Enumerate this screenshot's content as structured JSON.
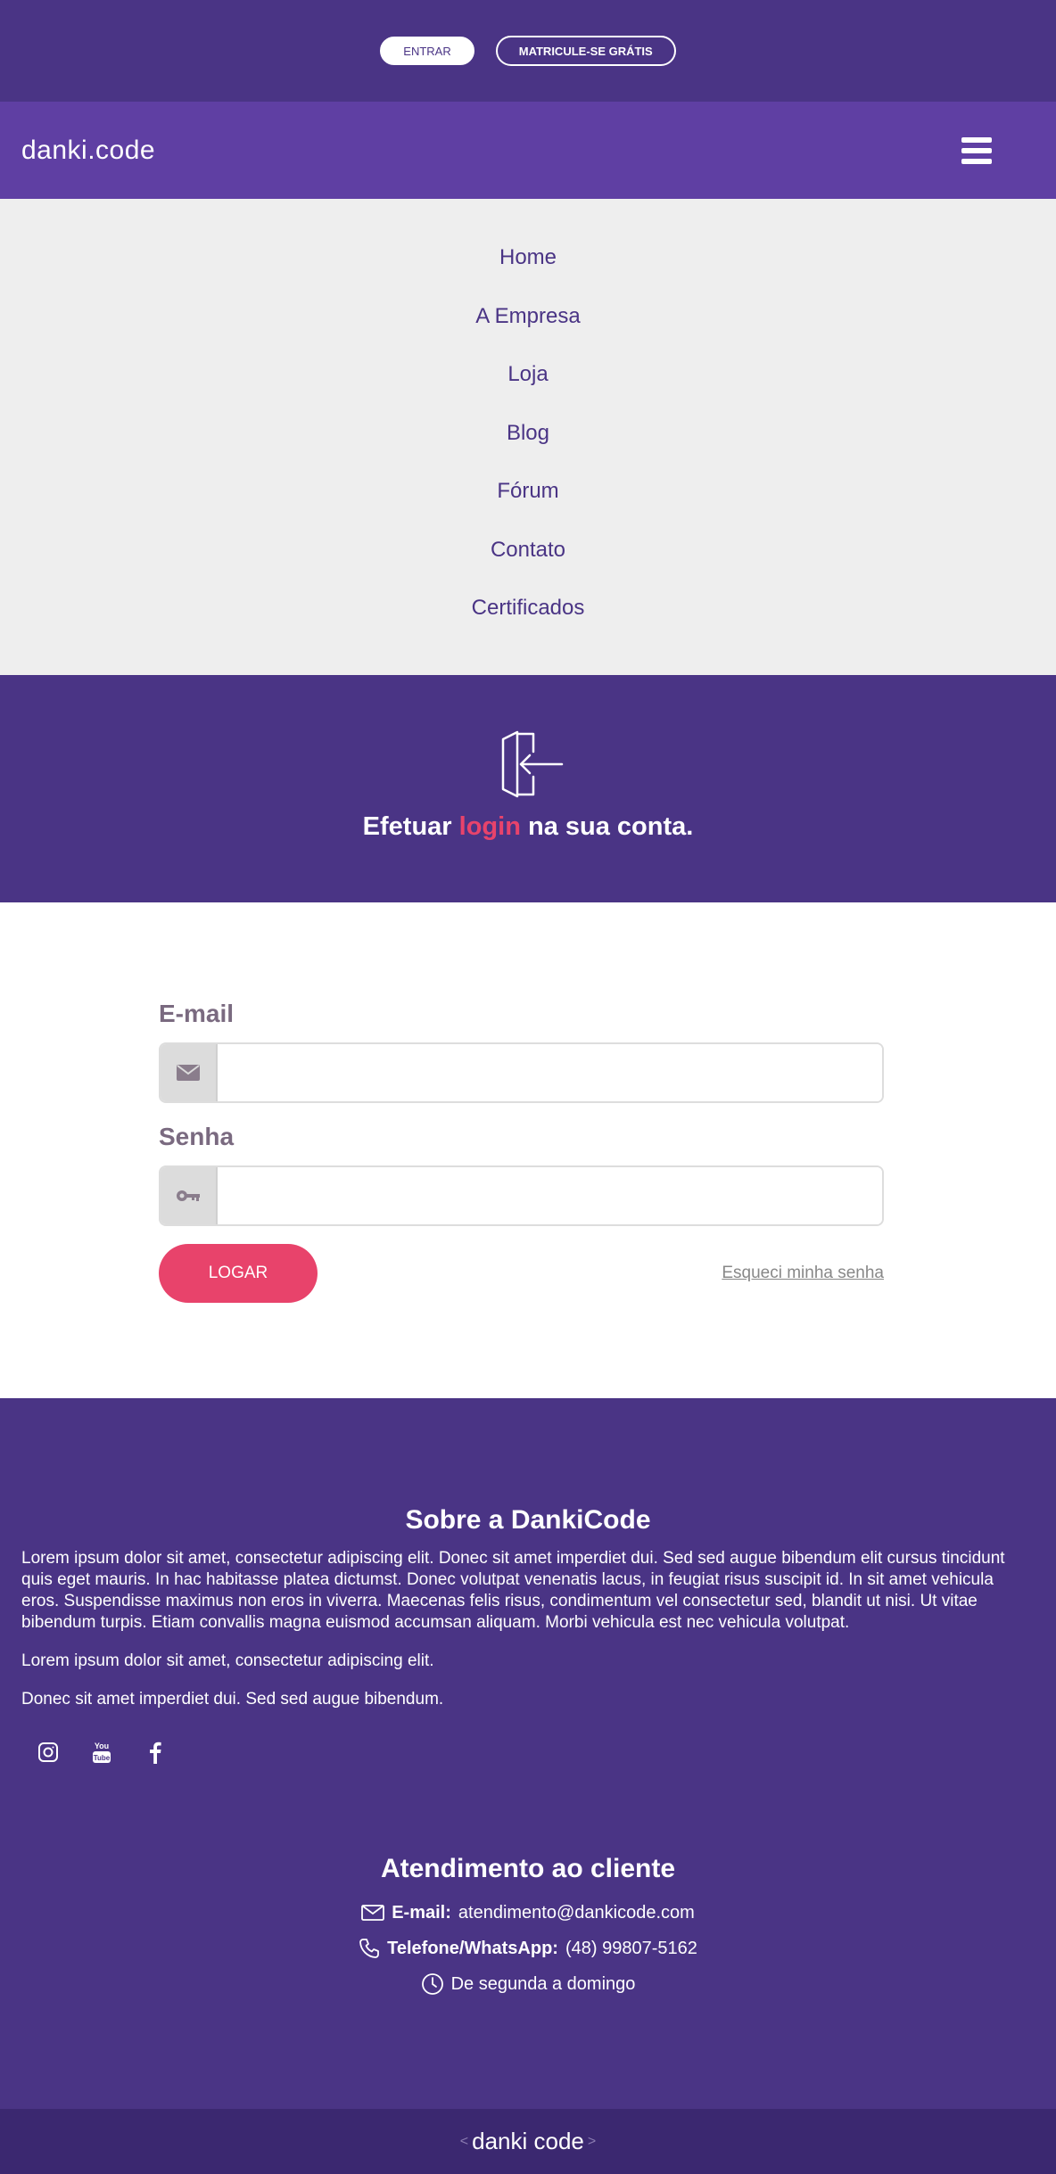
{
  "topbar": {
    "login_label": "ENTRAR",
    "signup_label": "MATRICULE-SE GRÁTIS"
  },
  "header": {
    "logo_text": "danki.code",
    "menu_icon": "hamburger-icon"
  },
  "nav": {
    "items": [
      {
        "label": "Home"
      },
      {
        "label": "A Empresa"
      },
      {
        "label": "Loja"
      },
      {
        "label": "Blog"
      },
      {
        "label": "Fórum"
      },
      {
        "label": "Contato"
      },
      {
        "label": "Certificados"
      }
    ]
  },
  "login_banner": {
    "icon": "door-enter-icon",
    "title_before": "Efetuar ",
    "title_accent": "login",
    "title_after": " na sua conta."
  },
  "form": {
    "email_label": "E-mail",
    "email_value": "",
    "email_icon": "envelope-icon",
    "password_label": "Senha",
    "password_value": "",
    "password_icon": "key-icon",
    "submit_label": "LOGAR",
    "forgot_label": "Esqueci minha senha"
  },
  "footer": {
    "about_title": "Sobre a DankiCode",
    "about_paragraphs": [
      "Lorem ipsum dolor sit amet, consectetur adipiscing elit. Donec sit amet imperdiet dui. Sed sed augue bibendum elit cursus tincidunt quis eget mauris. In hac habitasse platea dictumst. Donec volutpat venenatis lacus, in feugiat risus suscipit id. In sit amet vehicula eros. Suspendisse maximus non eros in viverra. Maecenas felis risus, condimentum vel consectetur sed, blandit ut nisi. Ut vitae bibendum turpis. Etiam convallis magna euismod accumsan aliquam. Morbi vehicula est nec vehicula volutpat.",
      "Lorem ipsum dolor sit amet, consectetur adipiscing elit.",
      "Donec sit amet imperdiet dui. Sed sed augue bibendum."
    ],
    "social_icons": [
      "instagram-icon",
      "youtube-icon",
      "facebook-icon"
    ],
    "support_title": "Atendimento ao cliente",
    "email_label": "E-mail:",
    "email_value": "atendimento@dankicode.com",
    "phone_label": "Telefone/WhatsApp:",
    "phone_value": "(48) 99807-5162",
    "hours_text": "De segunda a domingo"
  },
  "bottombar": {
    "bracket_left": "<",
    "logo_text": "danki code",
    "bracket_right": ">"
  },
  "colors": {
    "dark_purple": "#4a3485",
    "header_purple": "#5f3fa3",
    "accent_pink": "#e8436b",
    "nav_bg": "#eeeeee"
  }
}
